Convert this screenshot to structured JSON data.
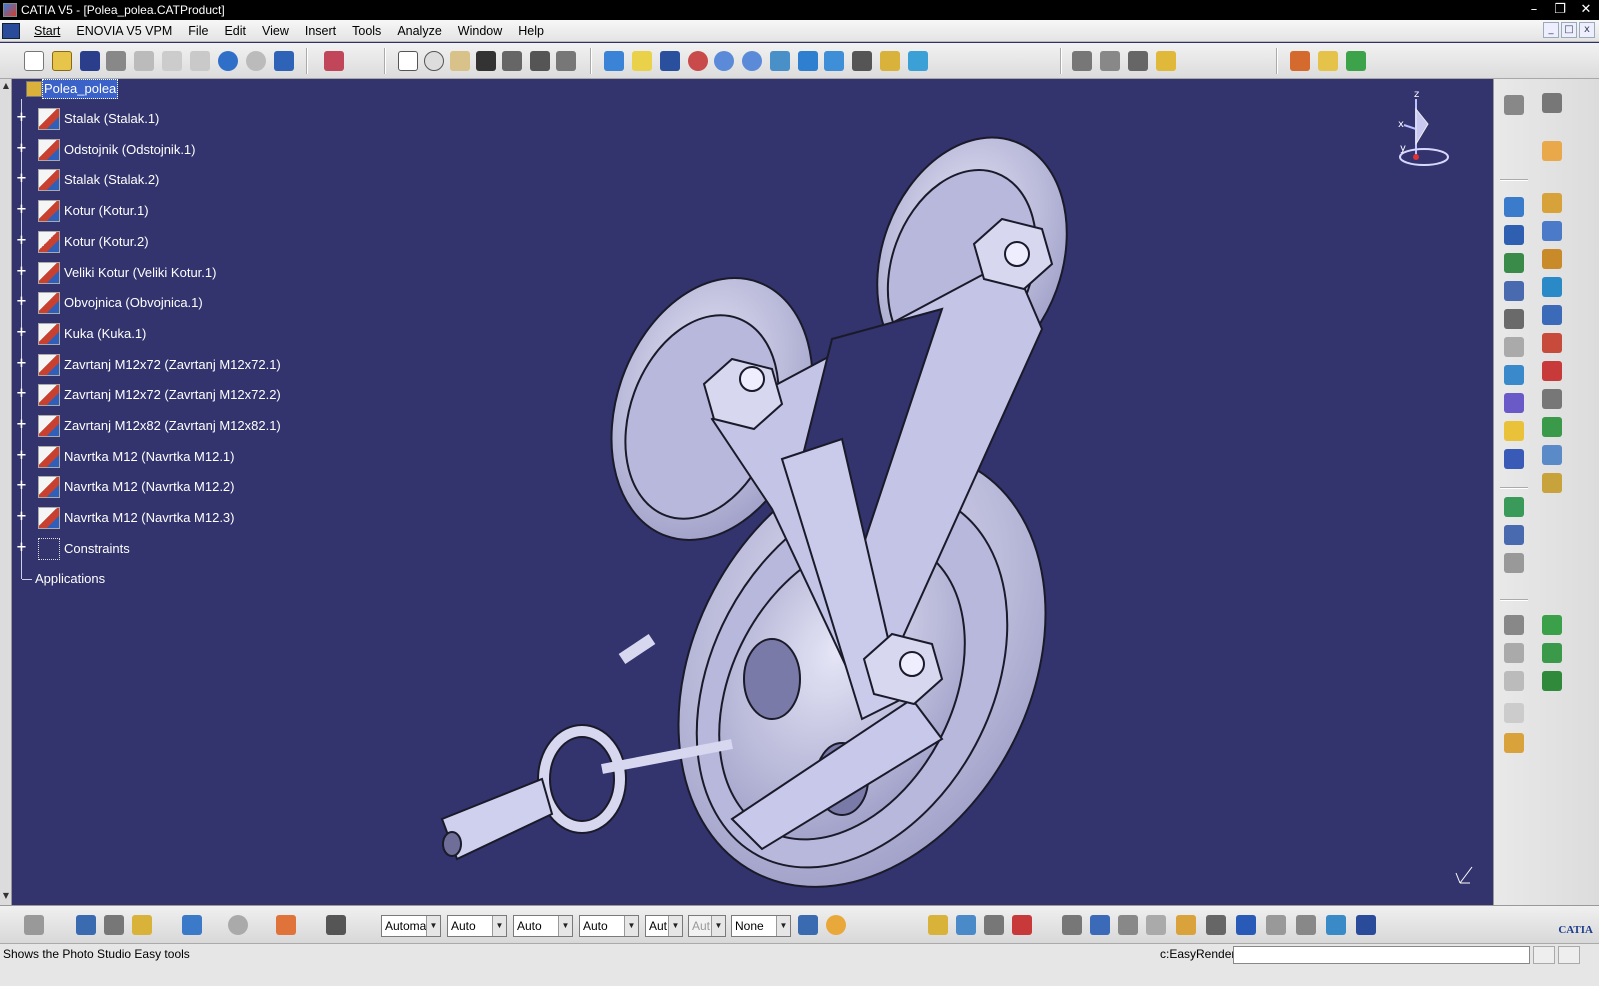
{
  "window": {
    "title": "CATIA V5 - [Polea_polea.CATProduct]",
    "controls": [
      "–",
      "❐",
      "✕"
    ]
  },
  "menubar": {
    "items": [
      "Start",
      "ENOVIA V5 VPM",
      "File",
      "Edit",
      "View",
      "Insert",
      "Tools",
      "Analyze",
      "Window",
      "Help"
    ]
  },
  "tree": {
    "root": "Polea_polea",
    "nodes": [
      {
        "label": "Stalak (Stalak.1)",
        "icon": "part-instance-icon"
      },
      {
        "label": "Odstojnik (Odstojnik.1)",
        "icon": "part-instance-icon"
      },
      {
        "label": "Stalak (Stalak.2)",
        "icon": "part-instance-icon"
      },
      {
        "label": "Kotur (Kotur.1)",
        "icon": "part-instance-icon"
      },
      {
        "label": "Kotur (Kotur.2)",
        "icon": "part-instance-icon"
      },
      {
        "label": "Veliki Kotur (Veliki Kotur.1)",
        "icon": "part-instance-icon"
      },
      {
        "label": "Obvojnica (Obvojnica.1)",
        "icon": "part-instance-icon"
      },
      {
        "label": "Kuka (Kuka.1)",
        "icon": "part-instance-icon"
      },
      {
        "label": "Zavrtanj M12x72 (Zavrtanj M12x72.1)",
        "icon": "part-instance-icon"
      },
      {
        "label": "Zavrtanj M12x72 (Zavrtanj M12x72.2)",
        "icon": "part-instance-icon"
      },
      {
        "label": "Zavrtanj M12x82 (Zavrtanj M12x82.1)",
        "icon": "part-instance-icon"
      },
      {
        "label": "Navrtka M12 (Navrtka M12.1)",
        "icon": "part-instance-icon"
      },
      {
        "label": "Navrtka M12 (Navrtka M12.2)",
        "icon": "part-instance-icon"
      },
      {
        "label": "Navrtka M12 (Navrtka M12.3)",
        "icon": "part-instance-icon"
      },
      {
        "label": "Constraints",
        "icon": "constraints-icon"
      }
    ],
    "applications": "Applications"
  },
  "compass": {
    "x": "x",
    "y": "y",
    "z": "z"
  },
  "bottom_toolbar": {
    "combos": [
      {
        "value": "Automa",
        "enabled": true
      },
      {
        "value": "Auto",
        "enabled": true
      },
      {
        "value": "Auto",
        "enabled": true
      },
      {
        "value": "Auto",
        "enabled": true
      },
      {
        "value": "Aut",
        "enabled": true
      },
      {
        "value": "Aut",
        "enabled": false
      },
      {
        "value": "None",
        "enabled": true
      }
    ],
    "brand": "CATIA"
  },
  "statusbar": {
    "message": "Shows the Photo Studio Easy tools",
    "command_label": "c:EasyRender",
    "command_value": ""
  },
  "colors": {
    "viewport_bg": "#33336e",
    "tree_text": "#ffffff",
    "selection": "#3a62c9",
    "model": "#c9c9e8"
  }
}
